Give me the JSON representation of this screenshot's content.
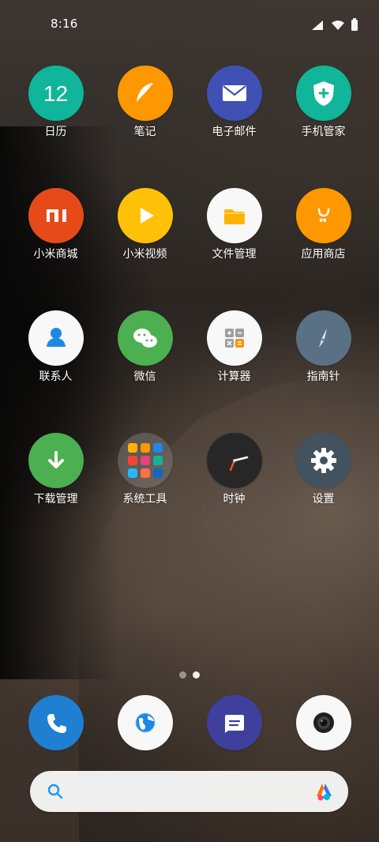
{
  "status_bar": {
    "time": "8:16",
    "icons": [
      "signal-icon",
      "wifi-icon",
      "battery-icon"
    ]
  },
  "apps": [
    {
      "label": "日历",
      "icon": "calendar-icon",
      "color": "#10b59a",
      "badge_text": "12"
    },
    {
      "label": "笔记",
      "icon": "notes-feather-icon",
      "color": "#ff9800"
    },
    {
      "label": "电子邮件",
      "icon": "mail-icon",
      "color": "#3f51b5"
    },
    {
      "label": "手机管家",
      "icon": "security-shield-icon",
      "color": "#10b59a"
    },
    {
      "label": "小米商城",
      "icon": "mi-store-icon",
      "color": "#e64a19"
    },
    {
      "label": "小米视频",
      "icon": "play-icon",
      "color": "#ffc107"
    },
    {
      "label": "文件管理",
      "icon": "folder-icon",
      "color": "#f8f8f8"
    },
    {
      "label": "应用商店",
      "icon": "app-store-bag-icon",
      "color": "#ff9800"
    },
    {
      "label": "联系人",
      "icon": "contacts-person-icon",
      "color": "#f8f8f8"
    },
    {
      "label": "微信",
      "icon": "wechat-icon",
      "color": "#4caf50"
    },
    {
      "label": "计算器",
      "icon": "calculator-icon",
      "color": "#f8f8f8"
    },
    {
      "label": "指南针",
      "icon": "compass-icon",
      "color": "#5a7185"
    },
    {
      "label": "下载管理",
      "icon": "download-icon",
      "color": "#4caf50"
    },
    {
      "label": "系统工具",
      "icon": "folder-system-tools-icon",
      "color": "#8a8a8a"
    },
    {
      "label": "时钟",
      "icon": "clock-icon",
      "color": "#272727"
    },
    {
      "label": "设置",
      "icon": "settings-gear-icon",
      "color": "#42535f"
    }
  ],
  "page_indicator": {
    "count": 2,
    "active_index": 1
  },
  "dock": [
    {
      "icon": "phone-icon",
      "color": "#1f7fd1"
    },
    {
      "icon": "browser-globe-icon",
      "color": "#f8f8f8"
    },
    {
      "icon": "messages-icon",
      "color": "#3f3f9e"
    },
    {
      "icon": "camera-icon",
      "color": "#f8f8f8"
    }
  ],
  "search_bar": {
    "left_icon": "search-icon",
    "right_icon": "assistant-logo-icon"
  }
}
